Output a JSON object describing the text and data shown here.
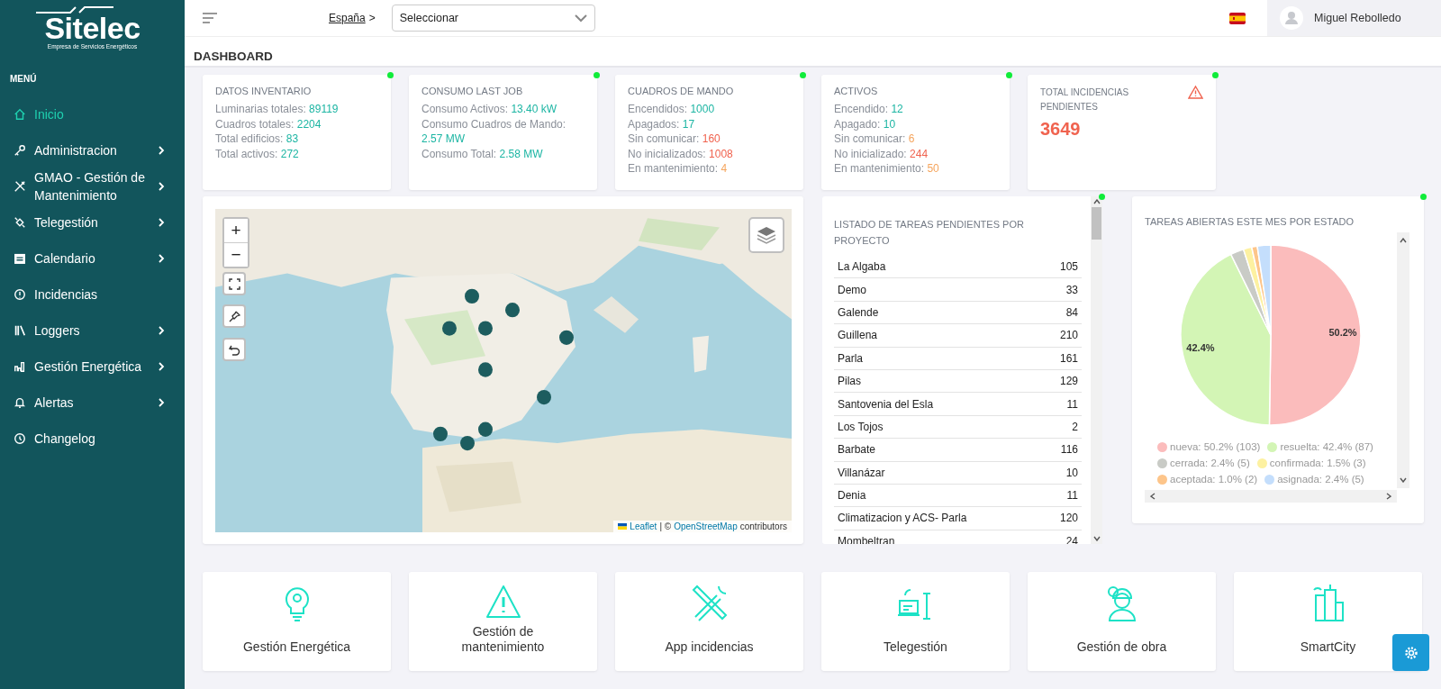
{
  "sidebar": {
    "logo": {
      "name": "Sitelec",
      "tagline": "Empresa de Servicios Energéticos"
    },
    "menu_title": "MENÚ",
    "items": [
      {
        "label": "Inicio",
        "expandable": false,
        "selected": true
      },
      {
        "label": "Administracion",
        "expandable": true,
        "selected": false
      },
      {
        "label": "GMAO - Gestión de Mantenimiento",
        "expandable": true,
        "selected": false
      },
      {
        "label": "Telegestión",
        "expandable": true,
        "selected": false
      },
      {
        "label": "Calendario",
        "expandable": true,
        "selected": false
      },
      {
        "label": "Incidencias",
        "expandable": false,
        "selected": false
      },
      {
        "label": "Loggers",
        "expandable": true,
        "selected": false
      },
      {
        "label": "Gestión Energética",
        "expandable": true,
        "selected": false
      },
      {
        "label": "Alertas",
        "expandable": true,
        "selected": false
      },
      {
        "label": "Changelog",
        "expandable": false,
        "selected": false
      }
    ]
  },
  "topbar": {
    "breadcrumb": "España",
    "breadcrumb_sep": ">",
    "select": {
      "value": "Seleccionar"
    },
    "user": "Miguel Rebolledo"
  },
  "page_title": "DASHBOARD",
  "stat_cards": [
    {
      "kind": "list",
      "title": "DATOS INVENTARIO",
      "online": true,
      "lines": [
        {
          "label": "Luminarias totales:",
          "value": "89119",
          "color": "#1cb5a3"
        },
        {
          "label": "Cuadros totales:",
          "value": "2204",
          "color": "#1cb5a3"
        },
        {
          "label": "Total edificios:",
          "value": "83",
          "color": "#1cb5a3"
        },
        {
          "label": "Total activos:",
          "value": "272",
          "color": "#1cb5a3"
        }
      ]
    },
    {
      "kind": "list",
      "title": "CONSUMO LAST JOB",
      "online": true,
      "lines": [
        {
          "label": "Consumo Activos:",
          "value": "13.40 kW",
          "color": "#1cb5a3"
        },
        {
          "label": "Consumo Cuadros de Mando:",
          "value": "2.57 MW",
          "color": "#1cb5a3"
        },
        {
          "label": "Consumo Total:",
          "value": "2.58 MW",
          "color": "#1cb5a3"
        }
      ]
    },
    {
      "kind": "list",
      "title": "CUADROS DE MANDO",
      "online": true,
      "lines": [
        {
          "label": "Encendidos:",
          "value": "1000",
          "color": "#1cb5a3"
        },
        {
          "label": "Apagados:",
          "value": "17",
          "color": "#1cb5a3"
        },
        {
          "label": "Sin comunicar:",
          "value": "160",
          "color": "#f0634f"
        },
        {
          "label": "No inicializados:",
          "value": "1008",
          "color": "#f0634f"
        },
        {
          "label": "En mantenimiento:",
          "value": "4",
          "color": "#f5a55d"
        }
      ]
    },
    {
      "kind": "list",
      "title": "ACTIVOS",
      "online": true,
      "lines": [
        {
          "label": "Encendido:",
          "value": "12",
          "color": "#1cb5a3"
        },
        {
          "label": "Apagado:",
          "value": "10",
          "color": "#1cb5a3"
        },
        {
          "label": "Sin comunicar:",
          "value": "6",
          "color": "#f5a55d"
        },
        {
          "label": "No inicializado:",
          "value": "244",
          "color": "#f0634f"
        },
        {
          "label": "En mantenimiento:",
          "value": "50",
          "color": "#f5a55d"
        }
      ]
    },
    {
      "kind": "total",
      "title": "TOTAL INCIDENCIAS PENDIENTES",
      "online": true,
      "value": "3649"
    }
  ],
  "map": {
    "zoom_in": "+",
    "zoom_out": "−",
    "attribution": {
      "leaflet": "Leaflet",
      "separator": "| ©",
      "osm": "OpenStreetMap",
      "tail": "contributors"
    }
  },
  "tasks": {
    "title": "LISTADO DE TAREAS PENDIENTES POR PROYECTO",
    "online": true,
    "rows": [
      {
        "name": "La Algaba",
        "count": "105"
      },
      {
        "name": "Demo",
        "count": "33"
      },
      {
        "name": "Galende",
        "count": "84"
      },
      {
        "name": "Guillena",
        "count": "210"
      },
      {
        "name": "Parla",
        "count": "161"
      },
      {
        "name": "Pilas",
        "count": "129"
      },
      {
        "name": "Santovenia del Esla",
        "count": "11"
      },
      {
        "name": "Los Tojos",
        "count": "2"
      },
      {
        "name": "Barbate",
        "count": "116"
      },
      {
        "name": "Villanázar",
        "count": "10"
      },
      {
        "name": "Denia",
        "count": "11"
      },
      {
        "name": "Climatizacion y ACS- Parla",
        "count": "120"
      },
      {
        "name": "Mombeltran",
        "count": "24"
      }
    ]
  },
  "status_chart": {
    "title": "TAREAS ABIERTAS ESTE MES POR ESTADO",
    "online": true,
    "chart_data": {
      "type": "pie",
      "categories": [
        "nueva",
        "resuelta",
        "cerrada",
        "confirmada",
        "aceptada",
        "asignada"
      ],
      "values": [
        50.2,
        42.4,
        2.4,
        1.5,
        1.0,
        2.4
      ],
      "colors": [
        "#fbbcbc",
        "#d3f5b5",
        "#c9cbc6",
        "#fdf1a1",
        "#fdc58a",
        "#c4defc"
      ],
      "value_labels": [
        "50.2%",
        "42.4%",
        null,
        null,
        null,
        null
      ]
    },
    "legend": [
      {
        "detail": ": 50.2% (103)"
      },
      {
        "detail": ": 42.4% (87)"
      },
      {
        "detail": ": 2.4% (5)"
      },
      {
        "detail": ": 1.5% (3)"
      },
      {
        "detail": ": 1.0% (2)"
      },
      {
        "detail": ": 2.4% (5)"
      }
    ]
  },
  "modules": [
    {
      "label": "Gestión Energética"
    },
    {
      "label": "Gestión de mantenimiento"
    },
    {
      "label": "App incidencias"
    },
    {
      "label": "Telegestión"
    },
    {
      "label": "Gestión de obra"
    },
    {
      "label": "SmartCity"
    }
  ]
}
